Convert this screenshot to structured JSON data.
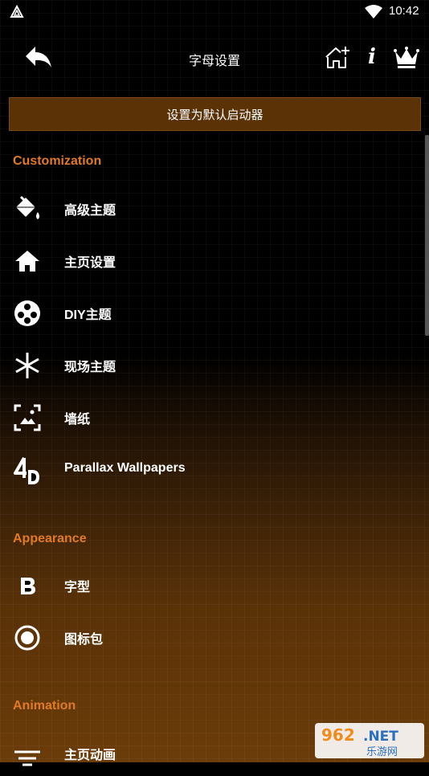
{
  "status_bar": {
    "time": "10:42"
  },
  "header": {
    "title": "字母设置",
    "back_icon": "back-arrow-icon",
    "home_icon": "home-add-icon",
    "info_label": "i",
    "crown_icon": "crown-icon"
  },
  "launcher_button": {
    "label": "设置为默认启动器"
  },
  "sections": {
    "customization": {
      "title": "Customization",
      "items": [
        {
          "label": "高级主题",
          "icon": "paint-bucket-icon"
        },
        {
          "label": "主页设置",
          "icon": "home-icon"
        },
        {
          "label": "DIY主题",
          "icon": "film-reel-icon"
        },
        {
          "label": "现场主题",
          "icon": "asterisk-icon"
        },
        {
          "label": "墙纸",
          "icon": "wallpaper-icon"
        },
        {
          "label": "Parallax Wallpapers",
          "icon": "4d-icon"
        }
      ]
    },
    "appearance": {
      "title": "Appearance",
      "items": [
        {
          "label": "字型",
          "icon": "bold-b-icon"
        },
        {
          "label": "图标包",
          "icon": "radio-target-icon"
        }
      ]
    },
    "animation": {
      "title": "Animation",
      "items": [
        {
          "label": "主页动画",
          "icon": "filter-lines-icon"
        }
      ]
    }
  },
  "watermark": {
    "text_top": "962.NET",
    "text_bottom": "乐游网"
  },
  "colors": {
    "accent": "#e07a26",
    "button_bg": "#5a3206",
    "background_top": "#000000",
    "background_bottom": "#6b3c09"
  }
}
